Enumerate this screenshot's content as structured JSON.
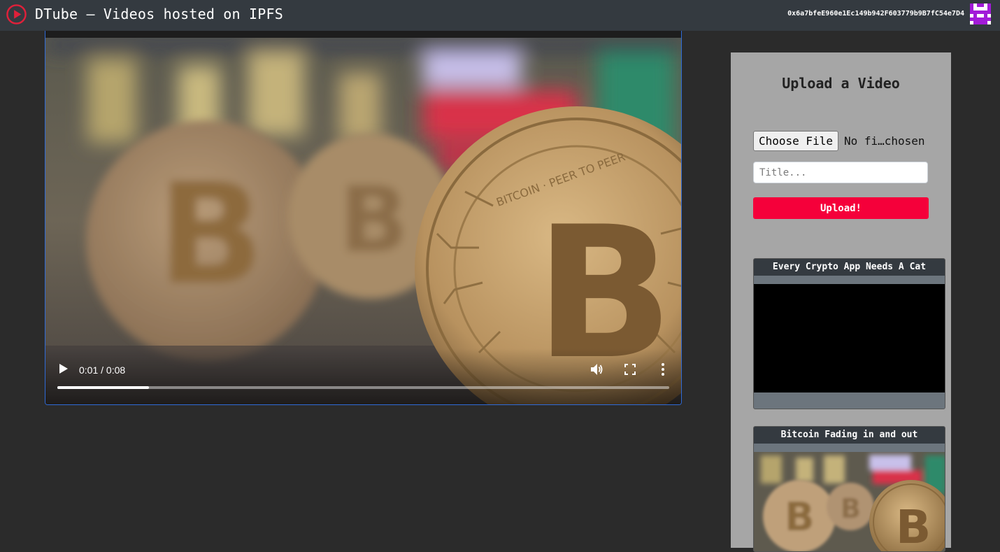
{
  "navbar": {
    "title": "DTube – Videos hosted on IPFS",
    "account": "0x6a7bfeE960e1Ec149b942F603779b9B7fC54e7D4",
    "logo_icon": "play-circle-icon",
    "avatar_icon": "identicon-avatar"
  },
  "player": {
    "current_time": "0:01",
    "duration": "0:08",
    "time_display": "0:01 / 0:08",
    "progress": 0.15,
    "poster": "bitcoin-coins"
  },
  "upload": {
    "heading": "Upload a Video",
    "choose_file_label": "Choose File",
    "file_status": "No fi…chosen",
    "title_placeholder": "Title...",
    "upload_label": "Upload!"
  },
  "video_list": [
    {
      "title": "Every Crypto App Needs A Cat",
      "thumbnail": "black"
    },
    {
      "title": "Bitcoin Fading in and out",
      "thumbnail": "bitcoin-coins"
    }
  ],
  "colors": {
    "navbar_bg": "#343a40",
    "page_bg": "#2b2b2b",
    "sidebar_bg": "#a6a6a6",
    "upload_button": "#f5003a",
    "logo_red": "#e0203a",
    "avatar_purple": "#a21bd8"
  }
}
